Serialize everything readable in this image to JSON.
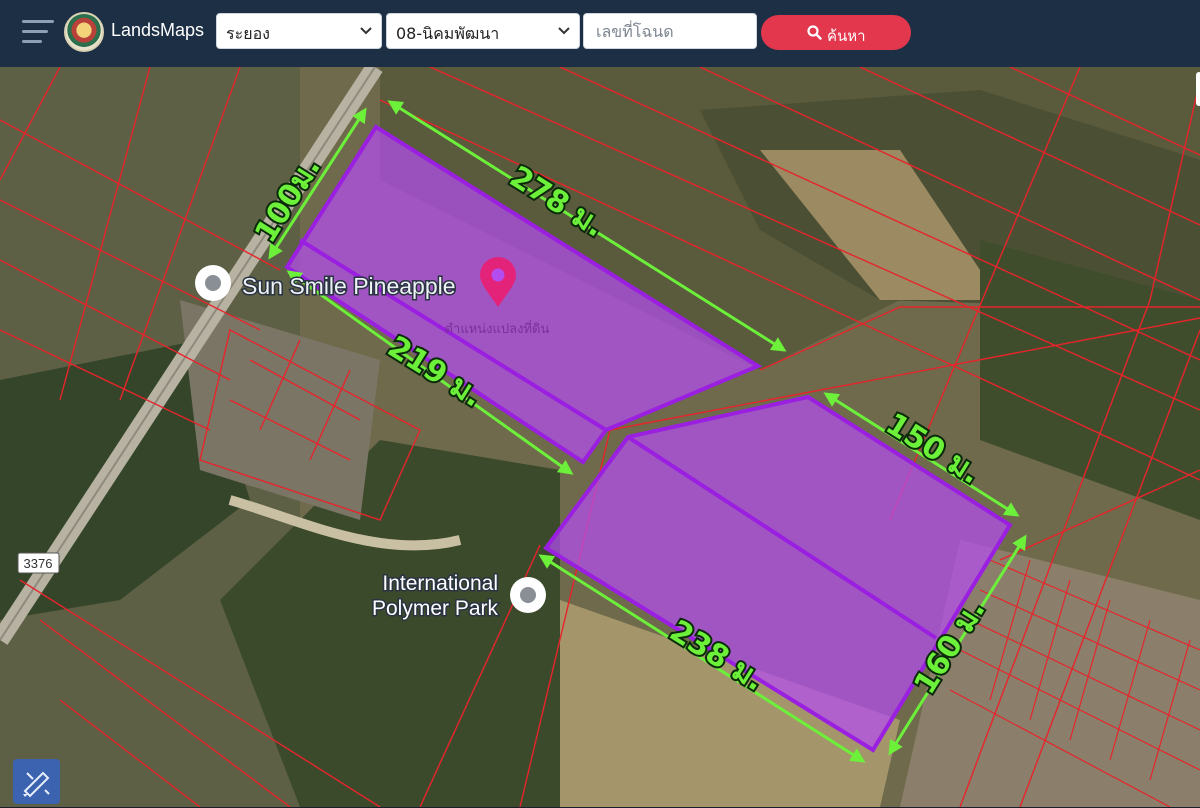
{
  "app": {
    "brand": "LandsMaps"
  },
  "filters": {
    "province": "ระยอง",
    "district": "08-นิคมพัฒนา",
    "deed_placeholder": "เลขที่โฉนด",
    "search_label": "ค้นหา"
  },
  "map": {
    "road_shield": "3376",
    "pois": {
      "sun_smile": "Sun Smile Pineapple",
      "polymer_line1": "International",
      "polymer_line2": "Polymer Park"
    },
    "pin_caption": "ตำแหน่งแปลงที่ดิน",
    "dimensions": {
      "top_short": "100ม.",
      "top_long": "278 ม.",
      "top_lower": "219 ม.",
      "right_top": "150 ม.",
      "right_side": "160 ม.",
      "bottom_long": "238 ม."
    },
    "colors": {
      "parcel_fill": "#b44df0",
      "parcel_stroke": "#9a1fe0",
      "boundary": "#e8242b",
      "dimension": "#6cf03a",
      "pin": "#e3237a"
    }
  },
  "icons": {
    "menu": "hamburger-icon",
    "search": "search-icon",
    "tool": "measure-tool-icon",
    "pin": "location-pin-icon",
    "poi": "poi-marker-icon"
  }
}
